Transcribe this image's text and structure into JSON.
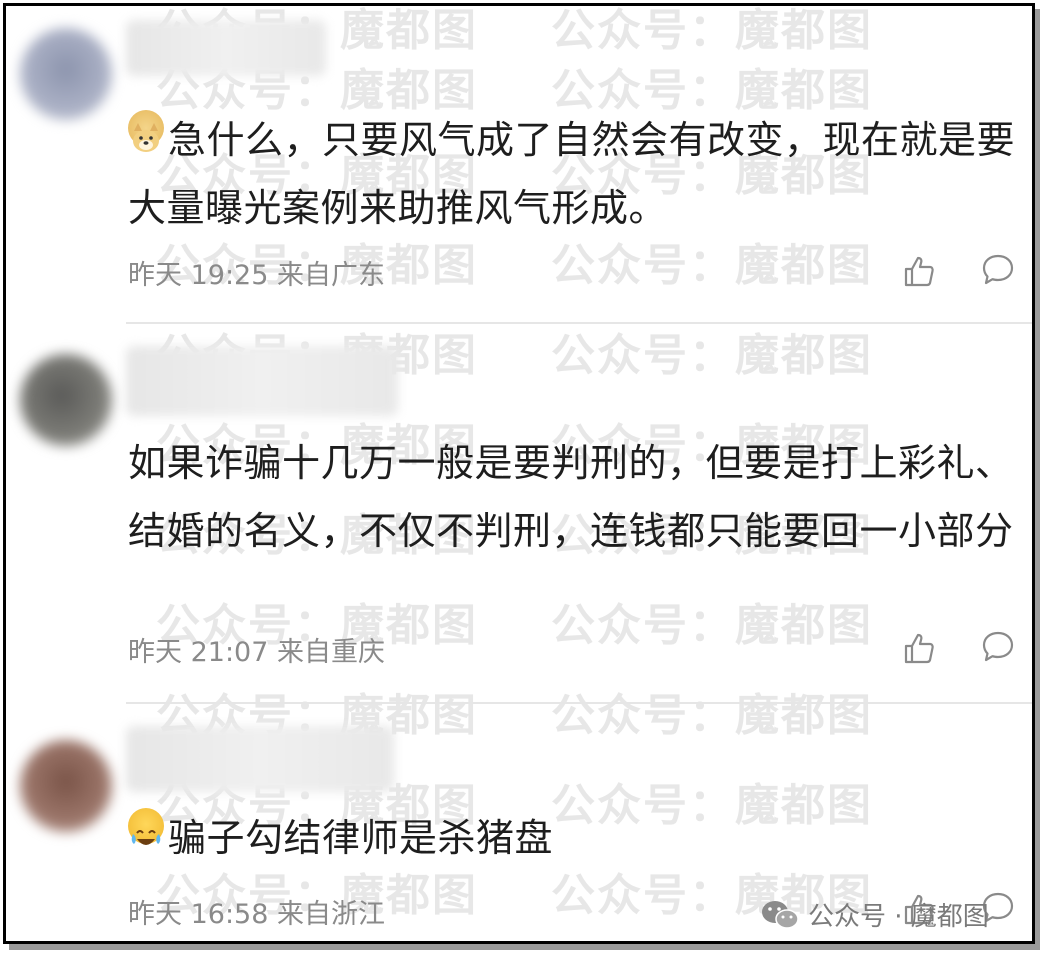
{
  "watermark": "公众号：魔都图",
  "comments": [
    {
      "text": "急什么，只要风气成了自然会有改变，现在就是要大量曝光案例来助推风气形成。",
      "emoji": "doge-emoji",
      "time": "昨天 19:25 来自广东"
    },
    {
      "text": "如果诈骗十几万一般是要判刑的，但要是打上彩礼、结婚的名义，不仅不判刑，连钱都只能要回一小部分",
      "time": "昨天 21:07 来自重庆"
    },
    {
      "text": "骗子勾结律师是杀猪盘",
      "emoji": "laugh-cry-emoji",
      "time": "昨天 16:58 来自浙江"
    }
  ],
  "footer_badge": {
    "label": "公众号 · 魔都图",
    "icon": "wechat-icon"
  },
  "colors": {
    "text": "#1e1e1e",
    "meta": "#8a8a8a",
    "divider": "#e6e6e6"
  }
}
